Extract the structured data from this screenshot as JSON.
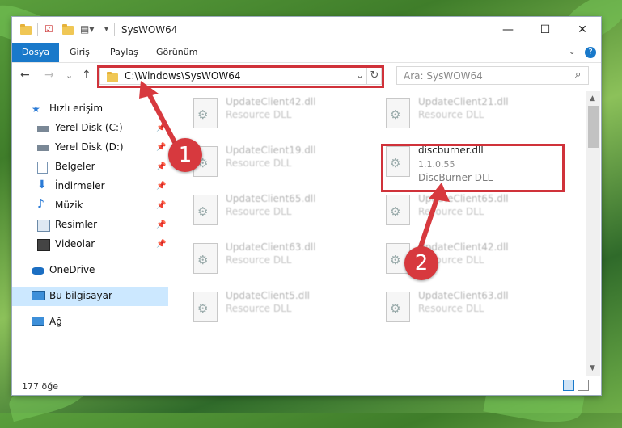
{
  "window": {
    "title": "SysWOW64",
    "controls": {
      "minimize": "—",
      "maximize": "☐",
      "close": "✕"
    }
  },
  "ribbon": {
    "tabs": [
      "Dosya",
      "Giriş",
      "Paylaş",
      "Görünüm"
    ],
    "expand_icon": "chevron-down-icon",
    "help_icon": "help-icon"
  },
  "navigation": {
    "back": "←",
    "forward": "→",
    "recent": "⌄",
    "up": "↑",
    "address": "C:\\Windows\\SysWOW64",
    "refresh": "↻",
    "dropdown": "⌄",
    "search_placeholder": "Ara: SysWOW64",
    "search_icon": "⌕"
  },
  "sidebar": {
    "items": [
      {
        "label": "Hızlı erişim",
        "icon": "star-icon"
      },
      {
        "label": "Yerel Disk (C:)",
        "icon": "drive-icon",
        "pinned": true
      },
      {
        "label": "Yerel Disk (D:)",
        "icon": "drive-icon",
        "pinned": true
      },
      {
        "label": "Belgeler",
        "icon": "documents-icon",
        "pinned": true
      },
      {
        "label": "İndirmeler",
        "icon": "download-icon",
        "pinned": true
      },
      {
        "label": "Müzik",
        "icon": "music-icon",
        "pinned": true
      },
      {
        "label": "Resimler",
        "icon": "pictures-icon",
        "pinned": true
      },
      {
        "label": "Videolar",
        "icon": "videos-icon",
        "pinned": true
      },
      {
        "label": "OneDrive",
        "icon": "cloud-icon"
      },
      {
        "label": "Bu bilgisayar",
        "icon": "computer-icon",
        "selected": true
      },
      {
        "label": "Ağ",
        "icon": "network-icon"
      }
    ]
  },
  "files": [
    {
      "name": "UpdateClient42.dll",
      "desc": "Resource DLL"
    },
    {
      "name": "UpdateClient21.dll",
      "desc": "Resource DLL"
    },
    {
      "name": "UpdateClient19.dll",
      "desc": "Resource DLL"
    },
    {
      "name": "discburner.dll",
      "version": "1.1.0.55",
      "desc": "DiscBurner DLL",
      "highlighted": true
    },
    {
      "name": "UpdateClient65.dll",
      "desc": "Resource DLL"
    },
    {
      "name": "UpdateClient65.dll",
      "desc": "Resource DLL"
    },
    {
      "name": "UpdateClient63.dll",
      "desc": "Resource DLL"
    },
    {
      "name": "UpdateClient42.dll",
      "desc": "Resource DLL"
    },
    {
      "name": "UpdateClient5.dll",
      "desc": "Resource DLL"
    },
    {
      "name": "UpdateClient63.dll",
      "desc": "Resource DLL"
    }
  ],
  "status": {
    "count": "177 öğe"
  },
  "annotations": {
    "step1": "1",
    "step2": "2",
    "color": "#d7393e"
  }
}
